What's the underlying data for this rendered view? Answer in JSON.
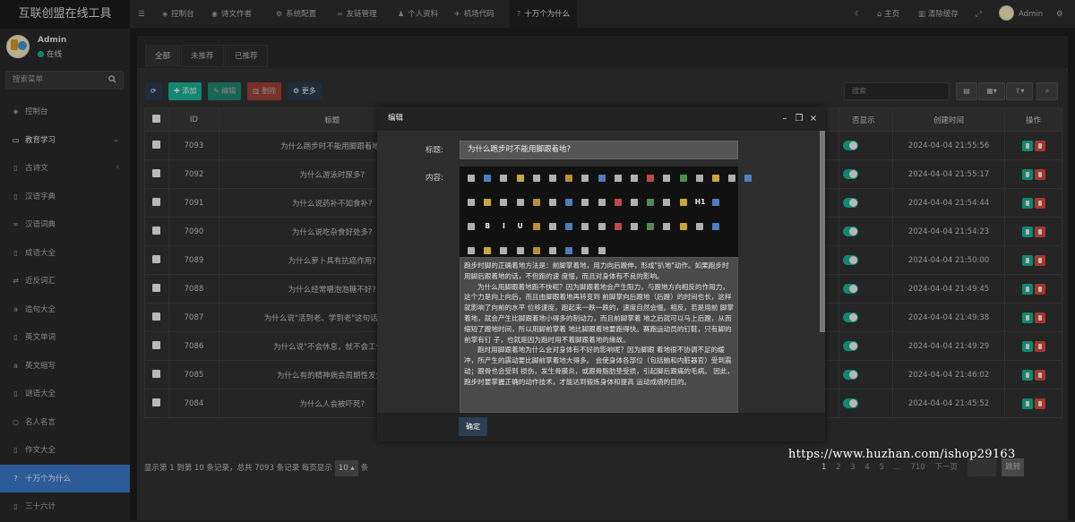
{
  "app": {
    "title": "互联创盟在线工具"
  },
  "user": {
    "name": "Admin",
    "status": "在线"
  },
  "sidebar": {
    "search_placeholder": "搜索菜单",
    "items": [
      {
        "label": "控制台",
        "icon": "dashboard-icon"
      },
      {
        "label": "教育学习",
        "icon": "monitor-icon",
        "section": true
      },
      {
        "label": "古诗文",
        "icon": "file-icon"
      },
      {
        "label": "汉语字典",
        "icon": "file-icon"
      },
      {
        "label": "汉语词典",
        "icon": "link-icon"
      },
      {
        "label": "成语大全",
        "icon": "file-icon"
      },
      {
        "label": "近反词汇",
        "icon": "shuffle-icon"
      },
      {
        "label": "造句大全",
        "icon": "amazon-icon"
      },
      {
        "label": "英文单词",
        "icon": "file-icon"
      },
      {
        "label": "英文缩写",
        "icon": "amazon-icon"
      },
      {
        "label": "谜语大全",
        "icon": "file-icon"
      },
      {
        "label": "名人名言",
        "icon": "circle-icon"
      },
      {
        "label": "作文大全",
        "icon": "file-icon"
      },
      {
        "label": "十万个为什么",
        "icon": "question-icon",
        "active": true
      },
      {
        "label": "三十六计",
        "icon": "file-icon"
      }
    ]
  },
  "topbar": {
    "tabs": [
      {
        "label": "控制台",
        "icon": "dashboard-icon"
      },
      {
        "label": "诗文作者",
        "icon": "car-icon"
      },
      {
        "label": "系统配置",
        "icon": "gear-icon"
      },
      {
        "label": "友链管理",
        "icon": "link-icon"
      },
      {
        "label": "个人资料",
        "icon": "user-icon"
      },
      {
        "label": "机场代码",
        "icon": "plane-icon"
      },
      {
        "label": "十万个为什么",
        "icon": "question-icon",
        "active": true
      }
    ],
    "home": "主页",
    "clear_cache": "清除缓存",
    "admin": "Admin"
  },
  "subtabs": [
    "全部",
    "未推荐",
    "已推荐"
  ],
  "toolbar": {
    "add": "添加",
    "edit": "编辑",
    "delete": "删除",
    "more": "更多",
    "search_placeholder": "搜索"
  },
  "table": {
    "headers": [
      "ID",
      "标题",
      "否显示",
      "创建时间",
      "操作"
    ],
    "rows": [
      {
        "id": "7093",
        "title": "为什么跑步时不能用脚跟着地?",
        "time": "2024-04-04 21:55:56"
      },
      {
        "id": "7092",
        "title": "为什么游泳时尿多?",
        "time": "2024-04-04 21:55:17"
      },
      {
        "id": "7091",
        "title": "为什么说药补不如食补?",
        "time": "2024-04-04 21:54:44"
      },
      {
        "id": "7090",
        "title": "为什么说吃杂食好处多?",
        "time": "2024-04-04 21:54:23"
      },
      {
        "id": "7089",
        "title": "为什么萝卜具有抗癌作用?",
        "time": "2024-04-04 21:50:00"
      },
      {
        "id": "7088",
        "title": "为什么经常嚼泡泡糖不好?",
        "time": "2024-04-04 21:49:45"
      },
      {
        "id": "7087",
        "title": "为什么说\"活到老、学到老\"这句话有医...",
        "time": "2024-04-04 21:49:38"
      },
      {
        "id": "7086",
        "title": "为什么说\"不会休息，就不会工作\"?",
        "time": "2024-04-04 21:49:29"
      },
      {
        "id": "7085",
        "title": "为什么有的精神病会周期性发生?",
        "time": "2024-04-04 21:46:02"
      },
      {
        "id": "7084",
        "title": "为什么人会被吓死?",
        "time": "2024-04-04 21:45:52"
      }
    ]
  },
  "footer": {
    "summary": "显示第 1 到第 10 条记录，总共 7093 条记录 每页显示",
    "per_page": "10",
    "suffix": "条",
    "pages": [
      "1",
      "2",
      "3",
      "4",
      "5",
      "...",
      "710",
      "下一页"
    ],
    "jump": "跳转"
  },
  "modal": {
    "title": "编辑",
    "title_label": "标题:",
    "title_value": "为什么跑步时不能用脚跟着地?",
    "content_label": "内容:",
    "para1": "跑步时脚的正确着地方法是：前脚掌着地，用力向后蹬伸，形成\"扒地\"动作。如果跑步时用脚后跟着地的话，不但跑的速 度慢，而且对身体有不良的影响。",
    "para2": "为什么用脚跟着地跑不快呢？因为脚跟着地会产生阻力，与蹬地方向相反的作用力，这个力是向上向后，而且由脚跟着地再转变到 前脚掌向后蹬地（后蹬）的时间也长，这样就影响了向前的水平 位移速度，跑起来一跌一跌的，速度自然会慢。相反，若是用前 脚掌着地，就会产生比脚跟着地小得多的制动力，而且前脚掌着 地之后就可以马上后蹬，从而缩短了蹬地时间，所以用脚前掌着 地比脚跟着地要跑得快。赛跑运动员的钉鞋，只有脚的前掌有钉 子，也就是因为跑时用不着脚跟着地的缘故。",
    "para3": "跑时用脚跟着地为什么会对身体有不好的影响呢？因为脚跟 着地很不协调不足的缓冲，所产生的震动要比脚前掌着地大得多。 会使身体各部位（包括脑和内脏器官）受到震动；跟骨也会受到 损伤，发生骨膜炎，或跟骨脂肪垫受损，引起脚后跟痛的毛病。 因此，跑步时要掌握正确的动作技术，才能达到锻炼身体和提高 运动成绩的目的。",
    "ok": "确定"
  },
  "watermark": "https://www.huzhan.com/ishop29163"
}
